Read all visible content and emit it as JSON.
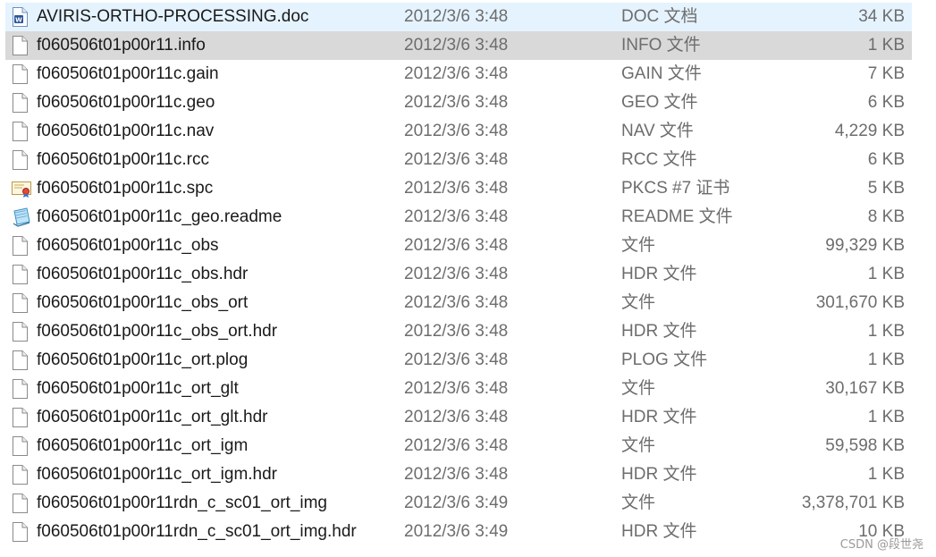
{
  "files": [
    {
      "name": "AVIRIS-ORTHO-PROCESSING.doc",
      "date": "2012/3/6 3:48",
      "type": "DOC 文档",
      "size": "34 KB",
      "icon": "word-doc-icon"
    },
    {
      "name": "f060506t01p00r11.info",
      "date": "2012/3/6 3:48",
      "type": "INFO 文件",
      "size": "1 KB",
      "icon": "file-icon"
    },
    {
      "name": "f060506t01p00r11c.gain",
      "date": "2012/3/6 3:48",
      "type": "GAIN 文件",
      "size": "7 KB",
      "icon": "file-icon"
    },
    {
      "name": "f060506t01p00r11c.geo",
      "date": "2012/3/6 3:48",
      "type": "GEO 文件",
      "size": "6 KB",
      "icon": "file-icon"
    },
    {
      "name": "f060506t01p00r11c.nav",
      "date": "2012/3/6 3:48",
      "type": "NAV 文件",
      "size": "4,229 KB",
      "icon": "file-icon"
    },
    {
      "name": "f060506t01p00r11c.rcc",
      "date": "2012/3/6 3:48",
      "type": "RCC 文件",
      "size": "6 KB",
      "icon": "file-icon"
    },
    {
      "name": "f060506t01p00r11c.spc",
      "date": "2012/3/6 3:48",
      "type": "PKCS #7 证书",
      "size": "5 KB",
      "icon": "certificate-icon"
    },
    {
      "name": "f060506t01p00r11c_geo.readme",
      "date": "2012/3/6 3:48",
      "type": "README 文件",
      "size": "8 KB",
      "icon": "notepad-icon"
    },
    {
      "name": "f060506t01p00r11c_obs",
      "date": "2012/3/6 3:48",
      "type": "文件",
      "size": "99,329 KB",
      "icon": "file-icon"
    },
    {
      "name": "f060506t01p00r11c_obs.hdr",
      "date": "2012/3/6 3:48",
      "type": "HDR 文件",
      "size": "1 KB",
      "icon": "file-icon"
    },
    {
      "name": "f060506t01p00r11c_obs_ort",
      "date": "2012/3/6 3:48",
      "type": "文件",
      "size": "301,670 KB",
      "icon": "file-icon"
    },
    {
      "name": "f060506t01p00r11c_obs_ort.hdr",
      "date": "2012/3/6 3:48",
      "type": "HDR 文件",
      "size": "1 KB",
      "icon": "file-icon"
    },
    {
      "name": "f060506t01p00r11c_ort.plog",
      "date": "2012/3/6 3:48",
      "type": "PLOG 文件",
      "size": "1 KB",
      "icon": "file-icon"
    },
    {
      "name": "f060506t01p00r11c_ort_glt",
      "date": "2012/3/6 3:48",
      "type": "文件",
      "size": "30,167 KB",
      "icon": "file-icon"
    },
    {
      "name": "f060506t01p00r11c_ort_glt.hdr",
      "date": "2012/3/6 3:48",
      "type": "HDR 文件",
      "size": "1 KB",
      "icon": "file-icon"
    },
    {
      "name": "f060506t01p00r11c_ort_igm",
      "date": "2012/3/6 3:48",
      "type": "文件",
      "size": "59,598 KB",
      "icon": "file-icon"
    },
    {
      "name": "f060506t01p00r11c_ort_igm.hdr",
      "date": "2012/3/6 3:48",
      "type": "HDR 文件",
      "size": "1 KB",
      "icon": "file-icon"
    },
    {
      "name": "f060506t01p00r11rdn_c_sc01_ort_img",
      "date": "2012/3/6 3:49",
      "type": "文件",
      "size": "3,378,701 KB",
      "icon": "file-icon"
    },
    {
      "name": "f060506t01p00r11rdn_c_sc01_ort_img.hdr",
      "date": "2012/3/6 3:49",
      "type": "HDR 文件",
      "size": "10 KB",
      "icon": "file-icon"
    }
  ],
  "selected_index": 1,
  "hover_index": 0,
  "watermark": "CSDN @段世尧"
}
